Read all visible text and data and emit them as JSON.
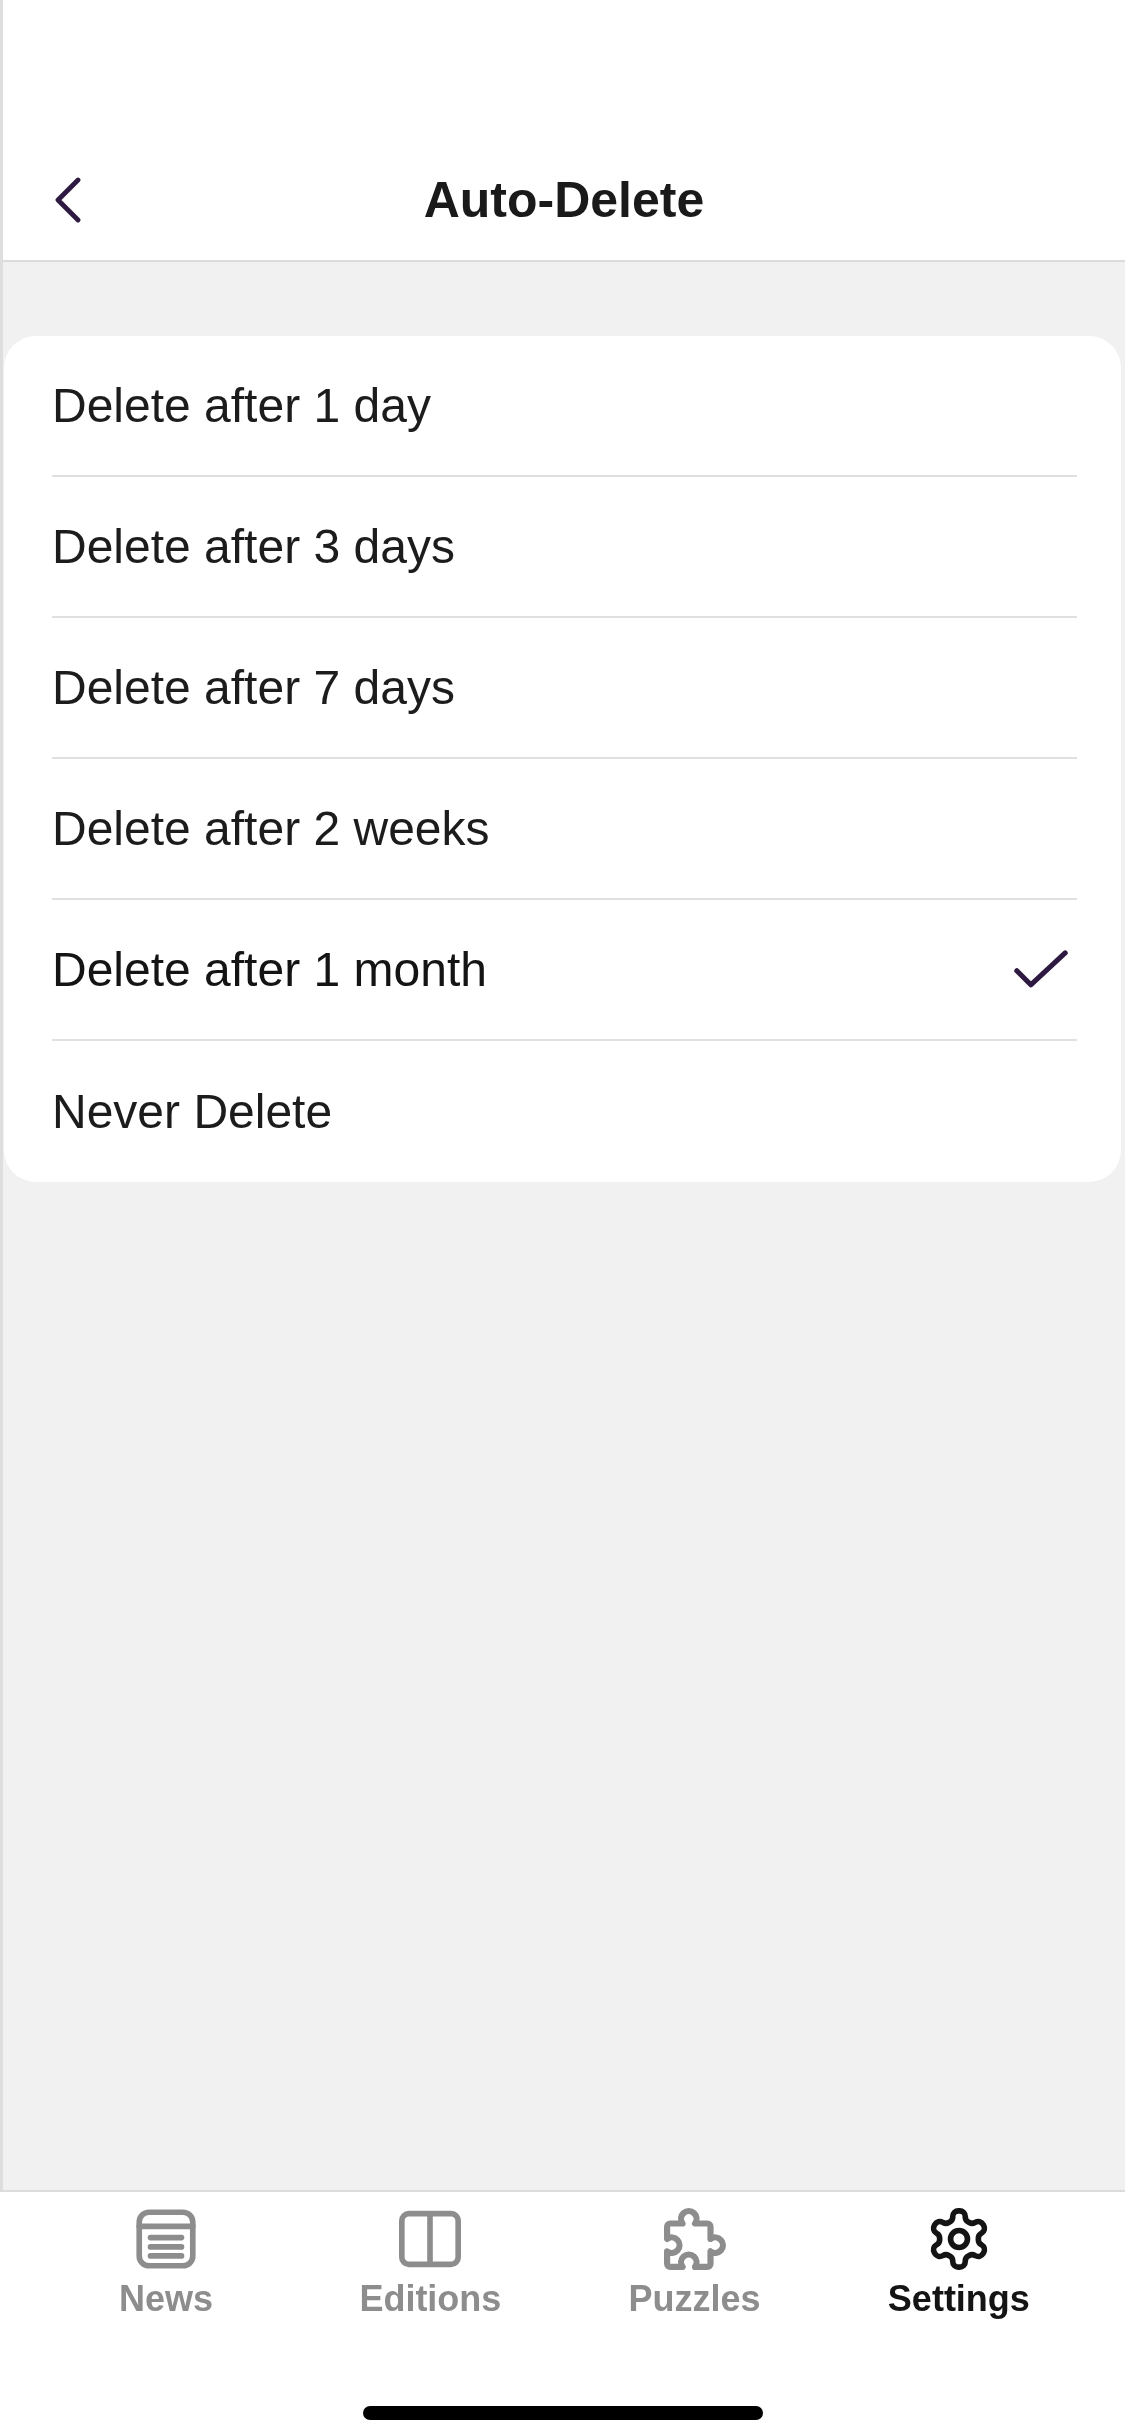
{
  "header": {
    "title": "Auto-Delete"
  },
  "options": [
    {
      "label": "Delete after 1 day",
      "selected": false
    },
    {
      "label": "Delete after 3 days",
      "selected": false
    },
    {
      "label": "Delete after 7 days",
      "selected": false
    },
    {
      "label": "Delete after 2 weeks",
      "selected": false
    },
    {
      "label": "Delete after 1 month",
      "selected": true
    },
    {
      "label": "Never Delete",
      "selected": false
    }
  ],
  "tab_bar": [
    {
      "label": "News",
      "selected": false
    },
    {
      "label": "Editions",
      "selected": false
    },
    {
      "label": "Puzzles",
      "selected": false
    },
    {
      "label": "Settings",
      "selected": true
    }
  ]
}
